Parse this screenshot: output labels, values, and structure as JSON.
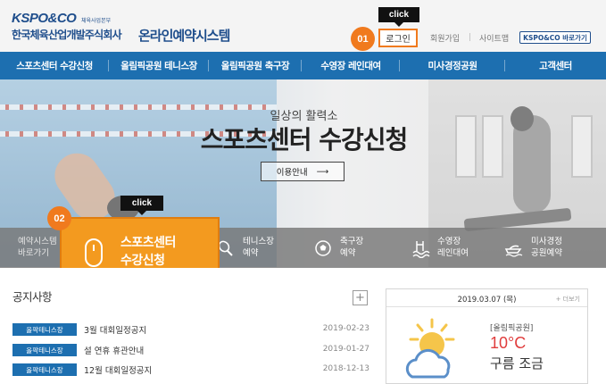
{
  "header": {
    "logo_text": "KSPO&CO",
    "logo_subtext": "체육사업본부",
    "company_name": "한국체육산업개발주식회사",
    "system_title": "온라인예약시스템",
    "login_label": "로그인",
    "join_label": "회원가입",
    "sitemap_label": "사이트맵",
    "kspo_button_label": "KSPO&CO 바로가기"
  },
  "nav": {
    "items": [
      {
        "label": "스포츠센터 수강신청"
      },
      {
        "label": "올림픽공원 테니스장"
      },
      {
        "label": "올림픽공원 축구장"
      },
      {
        "label": "수영장 레인대여"
      },
      {
        "label": "미사경정공원"
      },
      {
        "label": "고객센터"
      }
    ]
  },
  "hero": {
    "subtitle": "일상의 활력소",
    "title": "스포츠센터 수강신청",
    "guide_button_label": "이용안내",
    "guide_button_arrow": "⟶"
  },
  "quick_menu": {
    "first_line1": "예약시스템",
    "first_line2": "바로가기",
    "highlight_line1": "스포츠센터",
    "highlight_line2": "수강신청",
    "items": [
      {
        "line1": "테니스장",
        "line2": "예약",
        "icon": "tennis-racket-icon"
      },
      {
        "line1": "축구장",
        "line2": "예약",
        "icon": "soccer-ball-icon"
      },
      {
        "line1": "수영장",
        "line2": "레인대여",
        "icon": "swimming-icon"
      },
      {
        "line1": "미사경정",
        "line2": "공원예약",
        "icon": "boat-icon"
      }
    ]
  },
  "annotations": {
    "click_label": "click",
    "step1": "01",
    "step2": "02"
  },
  "notice": {
    "title": "공지사항",
    "plus": "+",
    "rows": [
      {
        "tag": "올팍테니스장",
        "text": "3월 대회일정공지",
        "date": "2019-02-23"
      },
      {
        "tag": "올팍테니스장",
        "text": "설 연휴 휴관안내",
        "date": "2019-01-27"
      },
      {
        "tag": "올팍테니스장",
        "text": "12월 대회일정공지",
        "date": "2018-12-13"
      }
    ]
  },
  "weather": {
    "date": "2019.03.07 (목)",
    "more_label": "+ 더보기",
    "location": "[올림픽공원]",
    "temperature": "10°C",
    "description": "구름 조금",
    "icon": "partly-cloudy-icon"
  },
  "colors": {
    "nav_blue": "#1d6fb0",
    "accent_orange": "#f39a1f",
    "temp_red": "#e03c3c"
  }
}
